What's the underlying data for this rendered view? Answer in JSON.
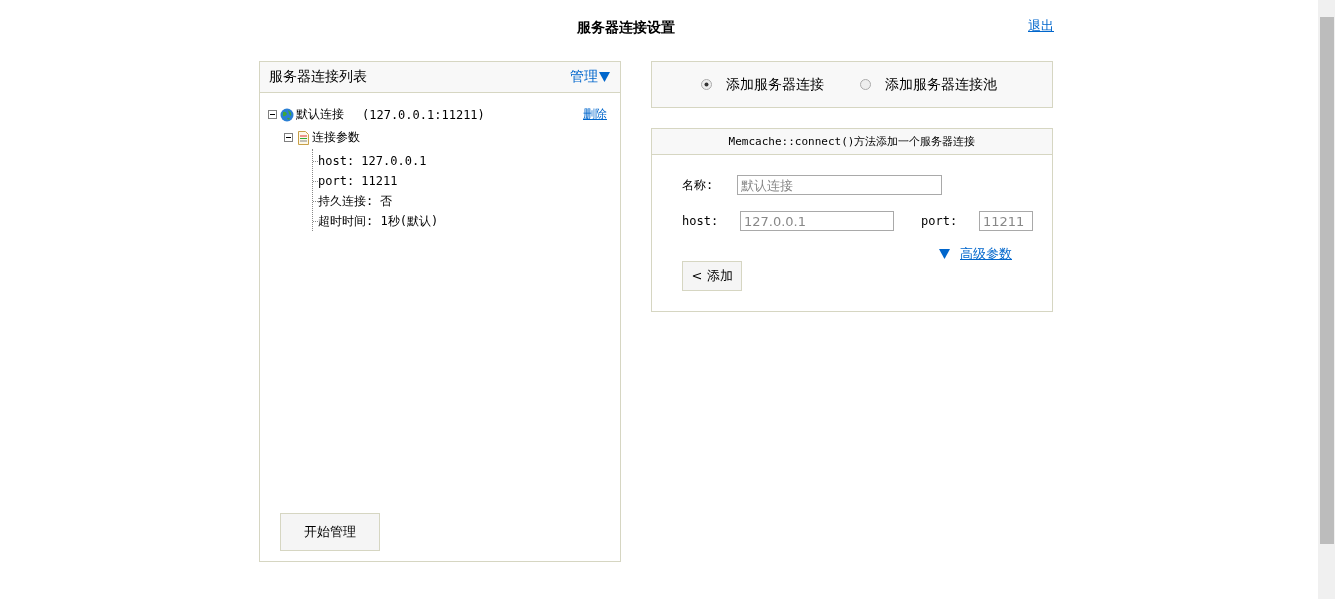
{
  "header": {
    "title": "服务器连接设置",
    "logout": "退出"
  },
  "server_list": {
    "title": "服务器连接列表",
    "manage_menu": "管理",
    "tree": [
      {
        "kind": "server",
        "expanded": true,
        "label": "默认连接",
        "address": "(127.0.0.1:11211)",
        "delete_link": "删除",
        "children": [
          {
            "kind": "group",
            "expanded": true,
            "label": "连接参数",
            "children": [
              {
                "kind": "param",
                "label": "host: 127.0.0.1"
              },
              {
                "kind": "param",
                "label": "port: 11211"
              },
              {
                "kind": "param",
                "label": "持久连接: 否"
              },
              {
                "kind": "param",
                "label": "超时时间: 1秒(默认)"
              }
            ]
          }
        ]
      }
    ],
    "start_button": "开始管理"
  },
  "mode_options": [
    {
      "label": "添加服务器连接",
      "selected": true
    },
    {
      "label": "添加服务器连接池",
      "selected": false
    }
  ],
  "add_form": {
    "title": "Memcache::connect()方法添加一个服务器连接",
    "name_field": {
      "label": "名称:",
      "placeholder": "默认连接"
    },
    "host_field": {
      "label": "host:",
      "placeholder": "127.0.0.1"
    },
    "port_field": {
      "label": "port:",
      "placeholder": "11211"
    },
    "advanced_link": "高级参数",
    "add_button": "< 添加"
  }
}
